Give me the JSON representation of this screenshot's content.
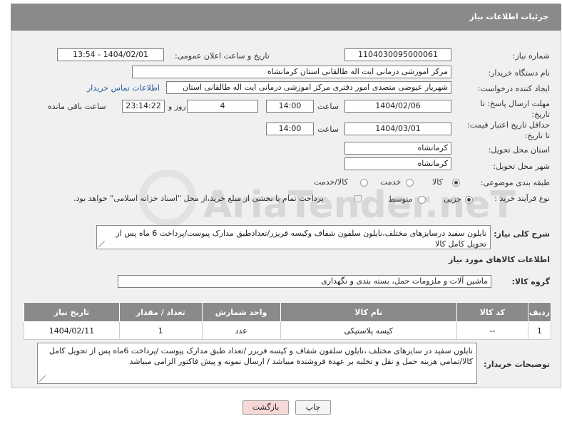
{
  "header": {
    "title": "جزئیات اطلاعات نیاز"
  },
  "fields": {
    "need_number_label": "شماره نیاز:",
    "need_number": "1104030095000061",
    "announce_label": "تاریخ و ساعت اعلان عمومی:",
    "announce_value": "1404/02/01 - 13:54",
    "buyer_label": "نام دستگاه خریدار:",
    "buyer_value": "مرکز اموزشی درمانی ایت اله طالقانی استان کرمانشاه",
    "creator_label": "ایجاد کننده درخواست:",
    "creator_value": "شهریار عیوضی متصدی امور دفتری مرکز اموزشی درمانی ایت اله طالقانی استان",
    "contact_link": "اطلاعات تماس خریدار",
    "deadline_label_1": "مهلت ارسال پاسخ: تا",
    "deadline_label_2": "تاریخ:",
    "deadline_date": "1404/02/06",
    "time_word": "ساعت",
    "deadline_time": "14:00",
    "days_value": "4",
    "days_word": "روز و",
    "remaining_time": "23:14:22",
    "remaining_word": "ساعت باقی مانده",
    "validity_label_1": "حداقل تاریخ اعتبار قیمت:",
    "validity_label_2": "تا تاریخ:",
    "validity_date": "1404/03/01",
    "validity_time": "14:00",
    "province_label": "استان محل تحویل:",
    "province_value": "کرمانشاه",
    "city_label": "شهر محل تحویل:",
    "city_value": "کرمانشاه",
    "category_label": "طبقه بندی موضوعی:",
    "category_options": [
      "کالا",
      "خدمت",
      "کالا/خدمت"
    ],
    "category_selected": "کالا",
    "process_label": "نوع فرآیند خرید :",
    "process_options": [
      "جزیی",
      "متوسط"
    ],
    "process_selected": "جزیی",
    "payment_note": "پرداخت تمام یا بخشی از مبلغ خرید،از محل \"اسناد خزانه اسلامی\" خواهد بود."
  },
  "description": {
    "label": "شرح کلی نیاز:",
    "text": "نایلون سفید درسایزهای مختلف،نایلون سلفون شفاف وکیسه فریزر/تعدادطبق مدارک پیوست/پرداخت 6 ماه پس از تحویل کامل کالا"
  },
  "goods_section": {
    "title": "اطلاعات کالاهای مورد نیاز",
    "group_label": "گروه کالا:",
    "group_value": "ماشین آلات و ملزومات حمل، بسته بندی و نگهداری"
  },
  "table": {
    "headers": [
      "ردیف",
      "کد کالا",
      "نام کالا",
      "واحد شمارش",
      "تعداد / مقدار",
      "تاریخ نیاز"
    ],
    "rows": [
      [
        "1",
        "--",
        "کیسه پلاستیکی",
        "عدد",
        "1",
        "1404/02/11"
      ]
    ]
  },
  "buyer_notes": {
    "label": "توضیحات خریدار:",
    "text": "نایلون سفید در سایزهای مختلف ،نایلون سلفون شفاف و کیسه فریزر /تعداد طبق مدارک پیوست /پرداخت 6ماه پس از تحویل کامل کالا/تمامی هزینه حمل و نقل و تخلیه بر عهدة فروشندة میباشد / ارسال نمونه و پیش فاکتور الزامی میباشد"
  },
  "buttons": {
    "print": "چاپ",
    "back": "بازگشت"
  },
  "watermark": {
    "text": "AriaTender.neT"
  },
  "colors": {
    "header": "#8a8a8a",
    "link": "#1f5a9a",
    "back_button": "#f8d7d7"
  }
}
